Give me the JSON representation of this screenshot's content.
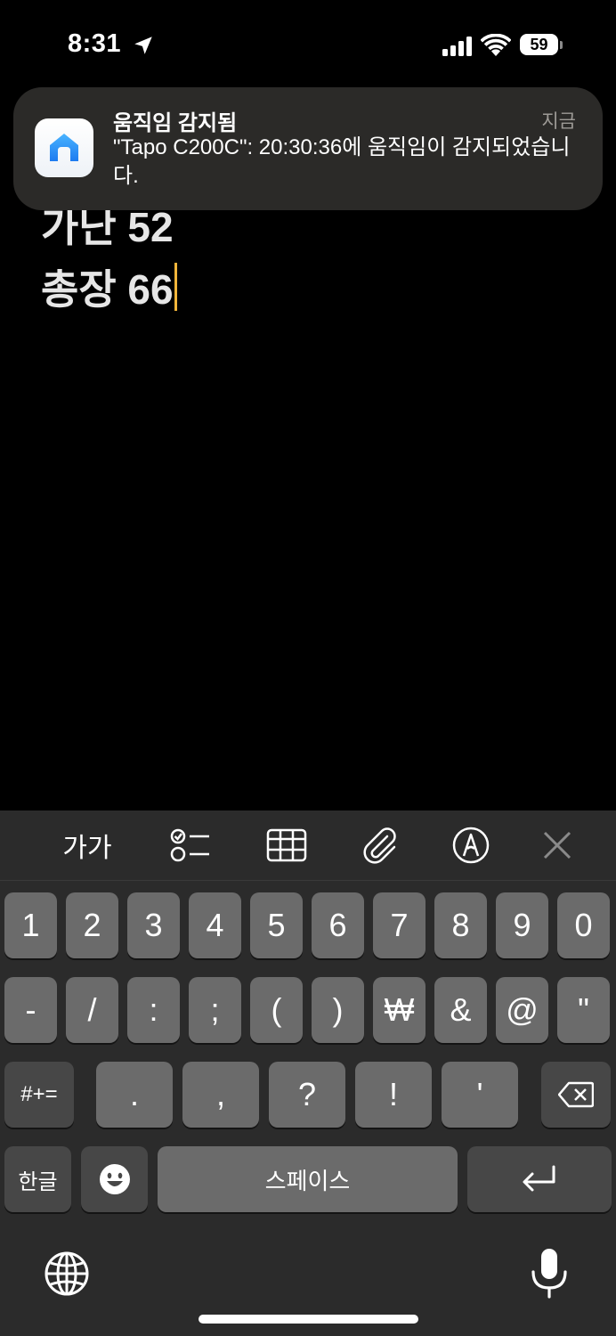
{
  "status_bar": {
    "time": "8:31",
    "battery": "59"
  },
  "note": {
    "lines": [
      "가난 52",
      "총장 66"
    ]
  },
  "notification": {
    "title": "움직임 감지됨",
    "time": "지금",
    "body": "\"Tapo C200C\": 20:30:36에 움직임이 감지되었습니다.",
    "app_icon": "home-app-icon"
  },
  "keyboard": {
    "toolbar": {
      "font": "가가"
    },
    "row1": [
      "1",
      "2",
      "3",
      "4",
      "5",
      "6",
      "7",
      "8",
      "9",
      "0"
    ],
    "row2": [
      "-",
      "/",
      ":",
      ";",
      "(",
      ")",
      "₩",
      "&",
      "@",
      "\""
    ],
    "row3": {
      "symbols": "#+=",
      "keys": [
        ".",
        ",",
        "?",
        "!",
        "'"
      ]
    },
    "row4": {
      "lang": "한글",
      "space": "스페이스"
    }
  }
}
